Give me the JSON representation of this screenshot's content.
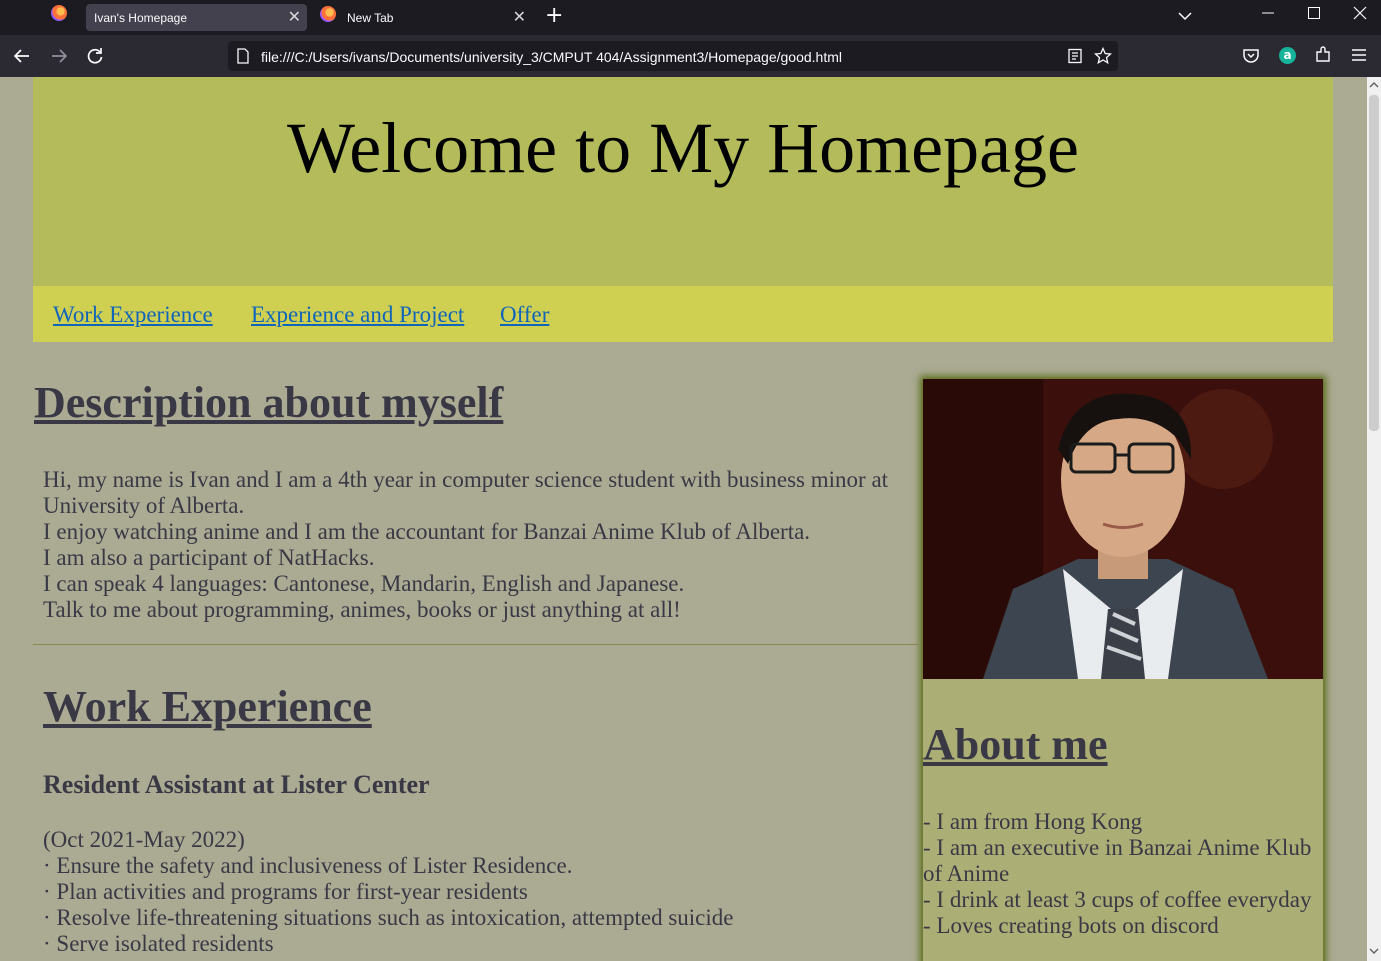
{
  "browser": {
    "tabs": [
      {
        "title": "Ivan's Homepage",
        "active": true
      },
      {
        "title": "New Tab",
        "active": false
      }
    ],
    "url": "file:///C:/Users/ivans/Documents/university_3/CMPUT 404/Assignment3/Homepage/good.html",
    "icons": [
      "firefox-icon",
      "close-icon",
      "plus-icon",
      "chevron-down-icon",
      "minimize-icon",
      "maximize-icon",
      "window-close-icon",
      "back-icon",
      "forward-icon",
      "reload-icon",
      "page-icon",
      "reader-view-icon",
      "star-icon",
      "pocket-icon",
      "account-icon",
      "extensions-icon",
      "menu-icon"
    ]
  },
  "header": {
    "title": "Welcome to My Homepage"
  },
  "nav": {
    "links": [
      "Work Experience",
      "Experience and Project",
      "Offer"
    ]
  },
  "description": {
    "title": "Description about myself",
    "lines": [
      "Hi, my name is Ivan and I am a 4th year in computer science student with business minor at University of Alberta.",
      "I enjoy watching anime and I am the accountant for Banzai Anime Klub of Alberta.",
      "I am also a participant of NatHacks.",
      "I can speak 4 languages: Cantonese, Mandarin, English and Japanese.",
      "Talk to me about programming, animes, books or just anything at all!"
    ]
  },
  "work": {
    "title": "Work Experience",
    "job_title": "Resident Assistant at Lister Center",
    "lines": [
      "(Oct 2021-May 2022)",
      "· Ensure the safety and inclusiveness of Lister Residence.",
      "· Plan activities and programs for first-year residents",
      "· Resolve life-threatening situations such as intoxication, attempted suicide",
      "· Serve isolated residents"
    ]
  },
  "aside": {
    "title": "About me",
    "items": [
      "- I am from Hong Kong",
      "- I am an executive in Banzai Anime Klub of Anime",
      "- I drink at least 3 cups of coffee everyday",
      "- Loves creating bots on discord"
    ]
  },
  "colors": {
    "page_bg": "#abab93",
    "header_bg": "#b4bb5b",
    "nav_bg": "#cfcf52",
    "link": "#0f65b9",
    "text": "#3a3845",
    "aside_bg": "#abae75"
  }
}
